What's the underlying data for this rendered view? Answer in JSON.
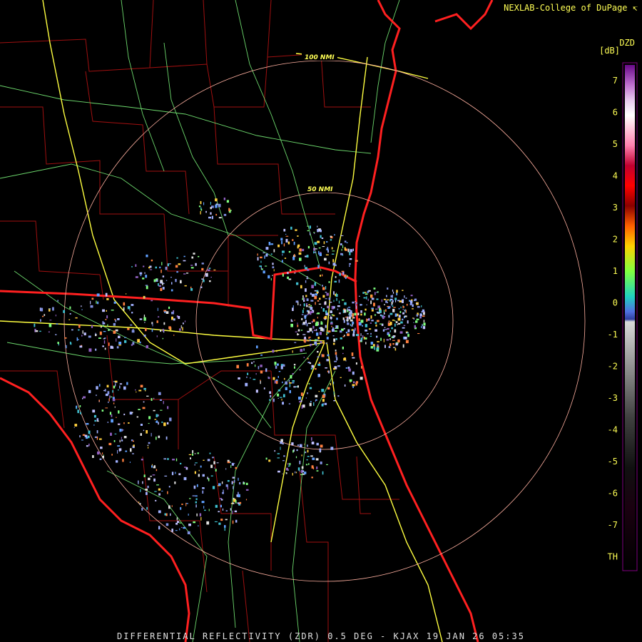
{
  "header": {
    "credit": "NEXLAB-College of DuPage",
    "credit_logo": "cod-logo-icon"
  },
  "product": {
    "code": "DZD",
    "units": "[dB]"
  },
  "caption": "DIFFERENTIAL REFLECTIVITY (ZDR) 0.5 DEG - KJAX 19 JAN 26 05:35",
  "range_rings": [
    "50 NMI",
    "100 NMI"
  ],
  "colorbar": {
    "labels": [
      "7",
      "6",
      "5",
      "4",
      "3",
      "2",
      "1",
      "0",
      "-1",
      "-2",
      "-3",
      "-4",
      "-5",
      "-6",
      "-7",
      "TH"
    ],
    "colors": {
      "frame": "#800080",
      "background": "#000000",
      "label": "#ffff55"
    }
  },
  "colors": {
    "state_border": "#ff2020",
    "county_border": "#a01010",
    "interstate": "#ffff40",
    "highway": "#80ff80",
    "range_ring": "#ffb0a0"
  }
}
